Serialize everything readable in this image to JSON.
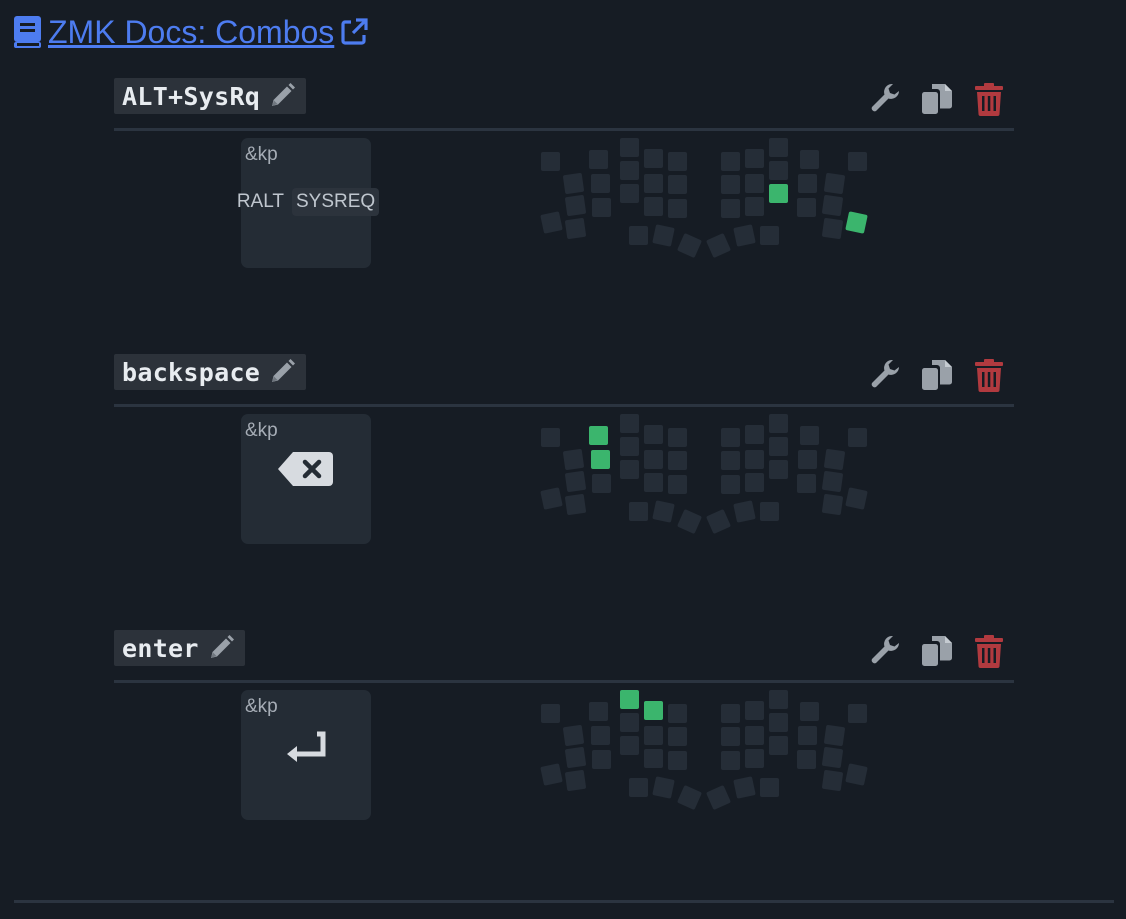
{
  "header": {
    "docs_link_label": "ZMK Docs: Combos",
    "icons": {
      "book": "book-icon",
      "external": "external-link-icon"
    },
    "link_color": "#4d7cf0"
  },
  "combos": [
    {
      "name": "ALT+SysRq",
      "behavior": "&kp",
      "binding_params": [
        "RALT",
        "SYSREQ"
      ],
      "binding_icon": null,
      "active_keys": [
        32,
        35
      ]
    },
    {
      "name": "backspace",
      "behavior": "&kp",
      "binding_params": [],
      "binding_icon": "backspace-icon",
      "active_keys": [
        1,
        6
      ]
    },
    {
      "name": "enter",
      "behavior": "&kp",
      "binding_params": [],
      "binding_icon": "enter-icon",
      "active_keys": [
        2,
        3
      ]
    }
  ],
  "actions": {
    "edit": "pencil-icon",
    "settings": "wrench-icon",
    "duplicate": "copy-icon",
    "delete": "trash-icon"
  },
  "colors": {
    "background": "#161c24",
    "key_inactive": "#252d37",
    "key_active": "#3bb56d",
    "delete": "#b13a3f",
    "action_gray": "#9aa1a9"
  }
}
